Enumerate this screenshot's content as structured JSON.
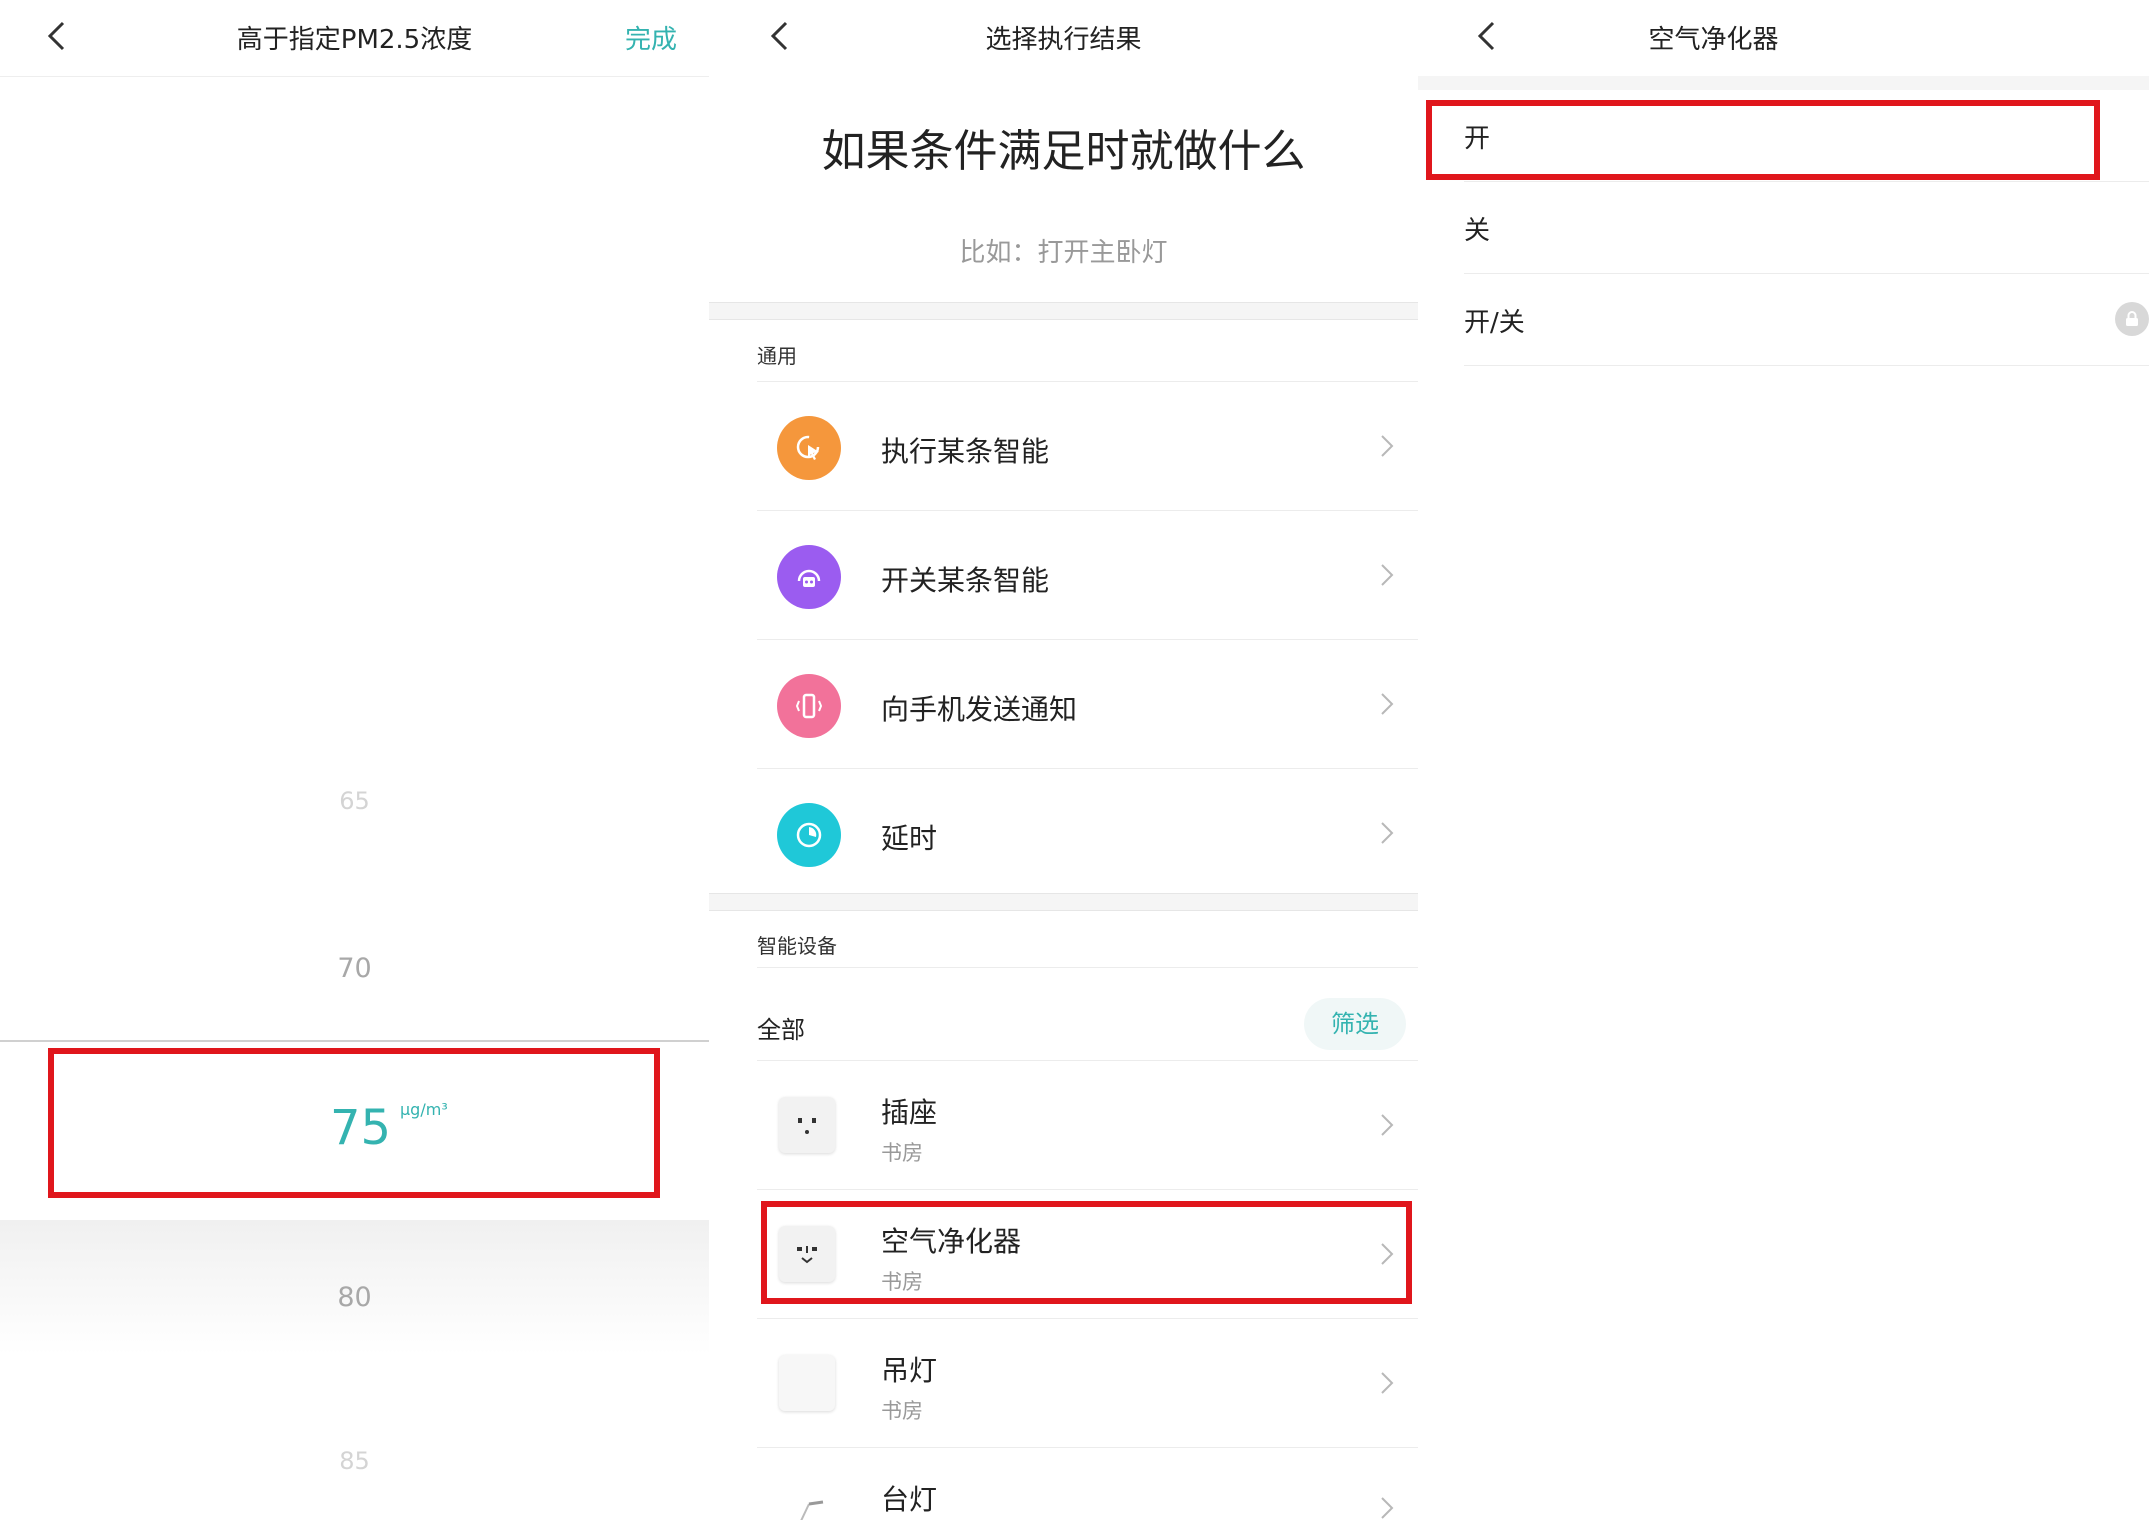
{
  "panel1": {
    "title": "高于指定PM2.5浓度",
    "done_label": "完成",
    "picker": {
      "ticks_above": [
        "65",
        "70"
      ],
      "selected_value": "75",
      "unit": "μg/m³",
      "ticks_below": [
        "80",
        "85"
      ]
    }
  },
  "panel2": {
    "title": "选择执行结果",
    "headline": "如果条件满足时就做什么",
    "hint": "比如：打开主卧灯",
    "section_general": "通用",
    "general_items": [
      {
        "label": "执行某条智能",
        "icon": "cursor-click-icon",
        "color": "#f5973c"
      },
      {
        "label": "开关某条智能",
        "icon": "robot-icon",
        "color": "#9b5cf0"
      },
      {
        "label": "向手机发送通知",
        "icon": "phone-vibrate-icon",
        "color": "#f2729a"
      },
      {
        "label": "延时",
        "icon": "timer-icon",
        "color": "#1fc8d8"
      }
    ],
    "section_devices": "智能设备",
    "all_label": "全部",
    "filter_label": "筛选",
    "devices": [
      {
        "name": "插座",
        "room": "书房",
        "icon": "socket-icon"
      },
      {
        "name": "空气净化器",
        "room": "书房",
        "icon": "air-purifier-icon"
      },
      {
        "name": "吊灯",
        "room": "书房",
        "icon": "pendant-lamp-icon"
      },
      {
        "name": "台灯",
        "room": "",
        "icon": "desk-lamp-icon"
      }
    ]
  },
  "panel3": {
    "title": "空气净化器",
    "options": [
      {
        "label": "开"
      },
      {
        "label": "关"
      },
      {
        "label": "开/关",
        "icon": "lock-icon"
      }
    ]
  },
  "colors": {
    "accent": "#34b3b0",
    "highlight": "#e0161c"
  }
}
